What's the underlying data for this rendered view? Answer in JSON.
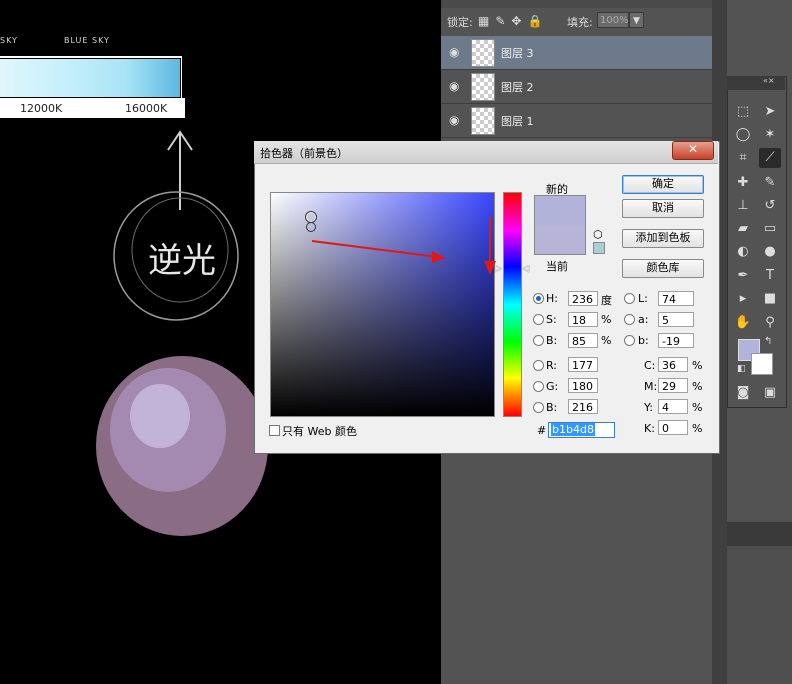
{
  "canvas": {
    "sky_left": "SKY",
    "sky_right": "BLUE SKY",
    "temp_left": "12000K",
    "temp_right": "16000K",
    "handwriting": "逆光"
  },
  "layers_panel": {
    "lock_label": "锁定:",
    "fill_label": "填充:",
    "fill_value": "100%",
    "layers": [
      {
        "name": "图层 3",
        "selected": true
      },
      {
        "name": "图层 2",
        "selected": false
      },
      {
        "name": "图层 1",
        "selected": false
      }
    ]
  },
  "color_picker": {
    "title": "拾色器（前景色）",
    "new_label": "新的",
    "current_label": "当前",
    "ok_label": "确定",
    "cancel_label": "取消",
    "add_swatch_label": "添加到色板",
    "color_lib_label": "颜色库",
    "web_only_label": "只有 Web 颜色",
    "new_color": "#b1b4d8",
    "current_color": "#b7b4d7",
    "hsb": {
      "h_label": "H:",
      "h_value": "236",
      "h_unit": "度",
      "s_label": "S:",
      "s_value": "18",
      "s_unit": "%",
      "b_label": "B:",
      "b_value": "85",
      "b_unit": "%"
    },
    "rgb": {
      "r_label": "R:",
      "r_value": "177",
      "g_label": "G:",
      "g_value": "180",
      "b_label": "B:",
      "b_value": "216"
    },
    "lab": {
      "l_label": "L:",
      "l_value": "74",
      "a_label": "a:",
      "a_value": "5",
      "b_label": "b:",
      "b_value": "-19"
    },
    "cmyk": {
      "c_label": "C:",
      "c_value": "36",
      "m_label": "M:",
      "m_value": "29",
      "y_label": "Y:",
      "y_value": "4",
      "k_label": "K:",
      "k_value": "0",
      "unit": "%"
    },
    "hex_label": "#",
    "hex_value": "b1b4d8"
  },
  "colors": {
    "accent_arrow": "#e01818",
    "selected_layer": "#6c7a8c",
    "panel_bg": "#535353"
  }
}
